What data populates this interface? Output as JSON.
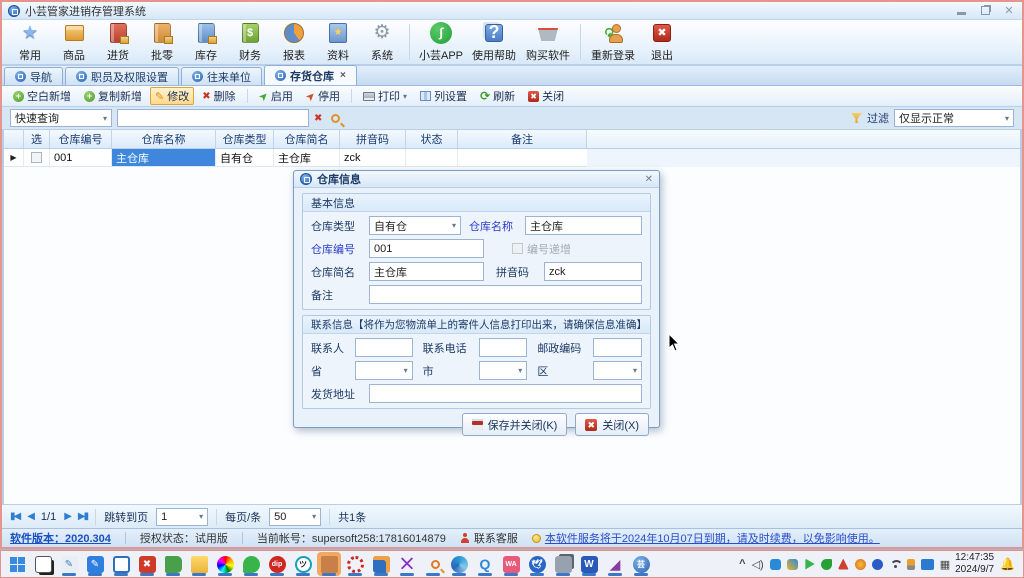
{
  "window": {
    "title": "小芸管家进销存管理系统"
  },
  "icons": {
    "close": "✕",
    "dropdown": "▾",
    "star": "★",
    "dollar": "$",
    "question": "?",
    "gear": "⚙",
    "pencil": "✎",
    "cross": "✖",
    "plus": "✚",
    "dart": "➤",
    "refresh": "⟳",
    "prev": "◀",
    "next": "▶",
    "first": "▮◀",
    "last": "▶▮",
    "row_marker": "▶",
    "tab_close": "×",
    "app_glyph": "ʃ",
    "chevron_up": "^",
    "volume": "🕪",
    "note_star": "★",
    "bell": "🔔"
  },
  "main_toolbar": {
    "items": [
      {
        "label": "常用"
      },
      {
        "label": "商品"
      },
      {
        "label": "进货"
      },
      {
        "label": "批零"
      },
      {
        "label": "库存"
      },
      {
        "label": "财务"
      },
      {
        "label": "报表"
      },
      {
        "label": "资料"
      },
      {
        "label": "系统"
      },
      {
        "label": "小芸APP"
      },
      {
        "label": "使用帮助"
      },
      {
        "label": "购买软件"
      },
      {
        "label": "重新登录"
      },
      {
        "label": "退出"
      }
    ]
  },
  "tabs": {
    "items": [
      {
        "label": "导航"
      },
      {
        "label": "职员及权限设置"
      },
      {
        "label": "往来单位"
      },
      {
        "label": "存货仓库"
      }
    ]
  },
  "action_toolbar": {
    "blank_new": "空白新增",
    "copy_new": "复制新增",
    "modify": "修改",
    "delete": "删除",
    "enable": "启用",
    "disable": "停用",
    "print": "打印",
    "columns": "列设置",
    "refresh": "刷新",
    "close": "关闭"
  },
  "search_row": {
    "quick_query": "快速查询",
    "filter_label": "过滤",
    "filter_value": "仅显示正常"
  },
  "table": {
    "headers": [
      "选",
      "仓库编号",
      "仓库名称",
      "仓库类型",
      "仓库简名",
      "拼音码",
      "状态",
      "备注"
    ],
    "row": {
      "code": "001",
      "name": "主仓库",
      "type": "自有仓",
      "short_name": "主仓库",
      "pinyin": "zck",
      "status": "",
      "remark": ""
    }
  },
  "dialog": {
    "title": "仓库信息",
    "groups": {
      "basic": "基本信息",
      "contact": "联系信息【将作为您物流单上的寄件人信息打印出来，请确保信息准确】"
    },
    "fields": {
      "type_label": "仓库类型",
      "type_value": "自有仓",
      "name_label": "仓库名称",
      "name_value": "主仓库",
      "code_label": "仓库编号",
      "code_value": "001",
      "autoincrement_label": "编号递增",
      "short_label": "仓库简名",
      "short_value": "主仓库",
      "pinyin_label": "拼音码",
      "pinyin_value": "zck",
      "remark_label": "备注",
      "contact_label": "联系人",
      "phone_label": "联系电话",
      "zip_label": "邮政编码",
      "province_label": "省",
      "city_label": "市",
      "district_label": "区",
      "address_label": "发货地址"
    },
    "buttons": {
      "save_close": "保存并关闭(K)",
      "close": "关闭(X)"
    }
  },
  "pagination": {
    "page": "1/1",
    "goto_label": "跳转到页",
    "goto_value": "1",
    "per_page_label": "每页/条",
    "per_page_value": "50",
    "total": "共1条"
  },
  "status_bar": {
    "version": "软件版本：2020.304",
    "license": "授权状态：试用版",
    "account": "当前帐号：supersoft258:17816014879",
    "support": "联系客服",
    "notice": "本软件服务将于2024年10月07日到期，请及时续费，以免影响使用。"
  },
  "taskbar": {
    "clock_time": "12:47:35",
    "clock_date": "2024/9/7",
    "app_icons": [
      "start",
      "task-view",
      "pen-tool",
      "notes-app",
      "window-app",
      "red-x-app",
      "green-book-app",
      "file-explorer",
      "color-wheel-app",
      "green-chat-app",
      "dip-app",
      "panda-app",
      "warehouse-app",
      "red-ring-app",
      "remote-app",
      "visual-studio",
      "search-orange",
      "browser-swirl",
      "qq-chat",
      "pink-wa-app",
      "blue-bird-app",
      "stacked-windows",
      "word",
      "purple-swoosh",
      "yun-app"
    ],
    "tray_icons": [
      "chevron-up",
      "volume",
      "blue-chat",
      "yellow-badge",
      "green-play",
      "green-dot",
      "red-pin",
      "orange-badge",
      "blue-n",
      "wifi",
      "usb",
      "display",
      "grid"
    ]
  },
  "colors": {
    "accent_blue": "#3f87dd",
    "selection": "#3f87dd",
    "highlight_orange": "#ffd98c",
    "window_border": "#e5958c",
    "taskbar_active": "#f0a95e"
  }
}
